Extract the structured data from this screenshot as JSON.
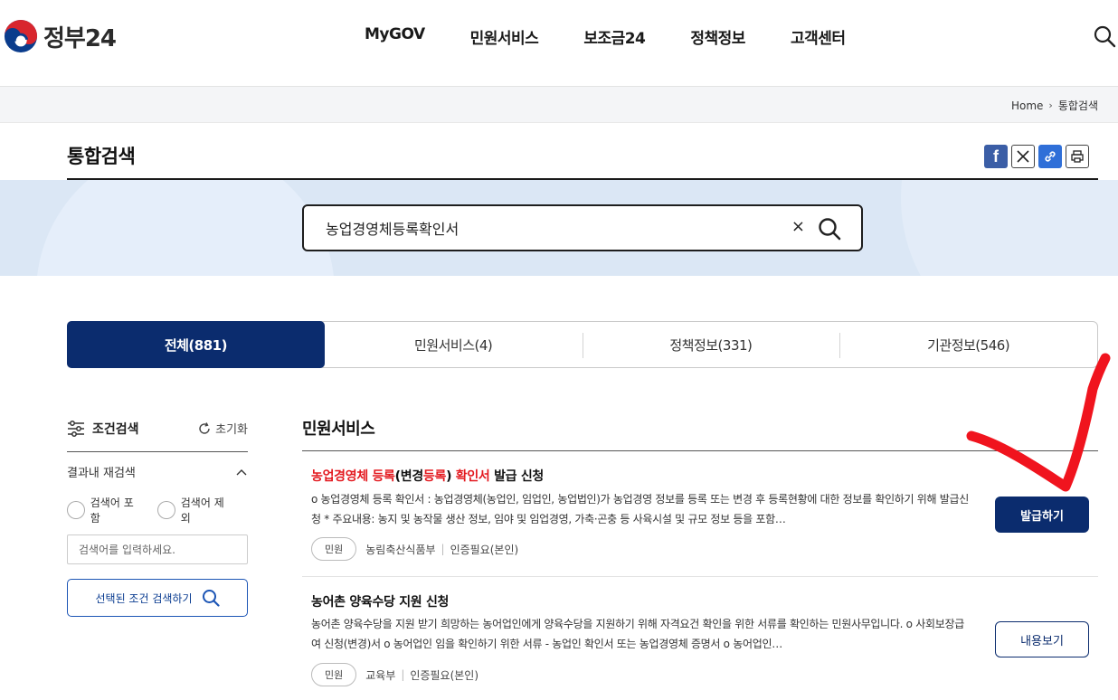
{
  "header": {
    "logo_text": "정부24",
    "nav": [
      "MyGOV",
      "민원서비스",
      "보조금24",
      "정책정보",
      "고객센터"
    ]
  },
  "breadcrumb": {
    "home": "Home",
    "current": "통합검색"
  },
  "page": {
    "title": "통합검색"
  },
  "share": {
    "facebook": "f"
  },
  "search": {
    "value": "농업경영체등록확인서",
    "clear": "×"
  },
  "tabs": [
    {
      "label": "전체(881)",
      "active": true
    },
    {
      "label": "민원서비스(4)",
      "active": false
    },
    {
      "label": "정책정보(331)",
      "active": false
    },
    {
      "label": "기관정보(546)",
      "active": false
    }
  ],
  "sidebar": {
    "title": "조건검색",
    "reset": "초기화",
    "refine_title": "결과내 재검색",
    "include": "검색어 포함",
    "exclude": "검색어 제외",
    "placeholder": "검색어를 입력하세요.",
    "search_button": "선택된 조건 검색하기"
  },
  "results": {
    "section_title": "민원서비스",
    "items": [
      {
        "title_parts": [
          "농업경영체 등록",
          "(변경",
          "등록",
          ") ",
          "확인서",
          " 발급 신청"
        ],
        "description": "o 농업경영체 등록 확인서 : 농업경영체(농업인, 임업인, 농업법인)가 농업경영 정보를 등록 또는 변경 후 등록현황에 대한 정보를 확인하기 위해 발급신청 * 주요내용: 농지 및 농작물 생산 정보, 임야 및 임업경영, 가축·곤충 등 사육시설 및 규모 정보 등을 포함…",
        "type": "민원",
        "agency": "농림축산식품부",
        "auth": "인증필요(본인)",
        "button": "발급하기"
      },
      {
        "title": "농어촌 양육수당 지원 신청",
        "description": "농어촌 양육수당을 지원 받기 희망하는 농어업인에게 양육수당을 지원하기 위해 자격요건 확인을 위한 서류를 확인하는 민원사무입니다. o 사회보장급여 신청(변경)서 o 농어업인 임을 확인하기 위한 서류 - 농업인 확인서 또는 농업경영체 증명서 o 농어업인…",
        "type": "민원",
        "agency": "교육부",
        "auth": "인증필요(본인)",
        "button": "내용보기"
      }
    ]
  },
  "colors": {
    "primary": "#0b2c6e",
    "highlight": "#e3191f",
    "annotation": "#f0141e"
  }
}
